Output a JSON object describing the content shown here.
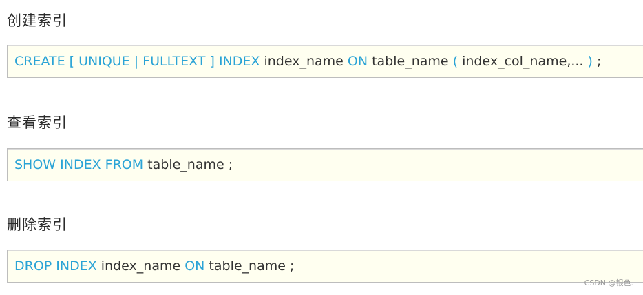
{
  "sections": [
    {
      "title": "创建索引",
      "tokens": [
        {
          "text": "CREATE [ UNIQUE | FULLTEXT ] INDEX",
          "kind": "kw"
        },
        {
          "text": " index_name ",
          "kind": "tx"
        },
        {
          "text": "ON",
          "kind": "kw"
        },
        {
          "text": " table_name ",
          "kind": "tx"
        },
        {
          "text": "(",
          "kind": "kw"
        },
        {
          "text": " index_col_name,... ",
          "kind": "tx"
        },
        {
          "text": ")",
          "kind": "kw"
        },
        {
          "text": " ;",
          "kind": "tx"
        }
      ]
    },
    {
      "title": "查看索引",
      "tokens": [
        {
          "text": "SHOW INDEX FROM",
          "kind": "kw"
        },
        {
          "text": " table_name ;",
          "kind": "tx"
        }
      ]
    },
    {
      "title": "删除索引",
      "tokens": [
        {
          "text": "DROP INDEX",
          "kind": "kw"
        },
        {
          "text": " index_name ",
          "kind": "tx"
        },
        {
          "text": "ON",
          "kind": "kw"
        },
        {
          "text": " table_name ;",
          "kind": "tx"
        }
      ]
    }
  ],
  "watermark": "CSDN @银色.",
  "colors": {
    "keyword": "#2aa3d6",
    "text": "#333333",
    "code_background": "#fffff0",
    "code_border": "#bdbdbd"
  }
}
